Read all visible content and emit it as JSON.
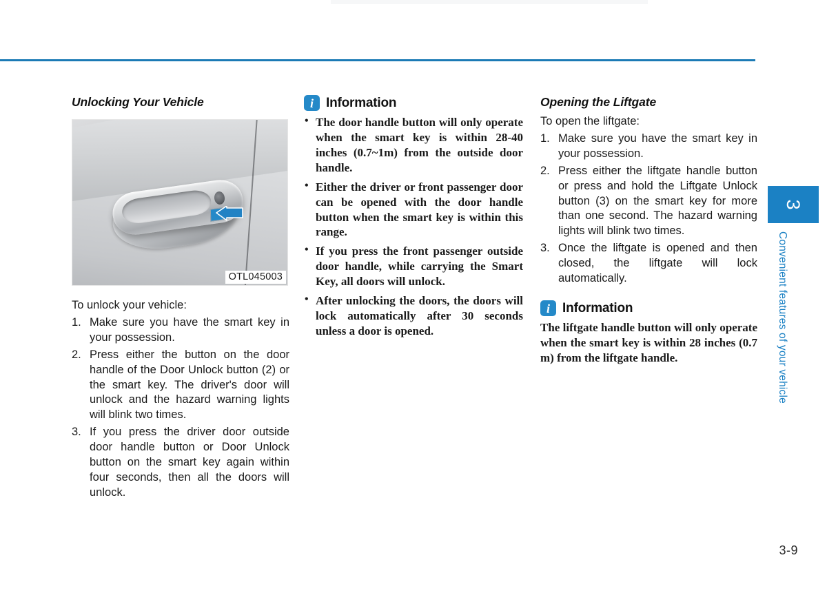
{
  "page": {
    "number": "3-9",
    "accent_color": "#1b81c4",
    "rule_color": "#1b7ab5"
  },
  "chapter_tab": {
    "number": "3",
    "label": "Convenient features of your vehicle"
  },
  "left_column": {
    "title": "Unlocking Your Vehicle",
    "figure": {
      "caption": "OTL045003",
      "icon": "car-door-handle-illustration",
      "arrow": "blue-arrow-pointing-to-door-handle-button"
    },
    "lead": "To unlock your vehicle:",
    "steps": [
      {
        "marker": "1.",
        "text": "Make sure you have the smart key in your possession."
      },
      {
        "marker": "2.",
        "text": "Press either the button on the door handle of the Door Unlock button (2) or the smart key. The driver's door will unlock and the hazard warning lights will blink two times."
      },
      {
        "marker": "3.",
        "text": "If you press the driver door outside door handle button or Door Unlock button on the smart key again within four seconds, then all the doors will unlock."
      }
    ]
  },
  "middle_column": {
    "information": {
      "icon": "information-icon",
      "title": "Information",
      "bullets": [
        "The door handle button will only operate when the smart key is within 28-40 inches (0.7~1m) from the outside door handle.",
        "Either the driver or front passenger door can be opened with the door handle button when the smart key is within this range.",
        "If you press the front passenger outside door handle, while carrying the Smart Key, all doors will unlock.",
        "After unlocking the doors, the doors will lock automatically after 30 seconds unless a door is opened."
      ]
    }
  },
  "right_column": {
    "title": "Opening the Liftgate",
    "lead": "To open the liftgate:",
    "steps": [
      {
        "marker": "1.",
        "text": "Make sure you have the smart key in your possession."
      },
      {
        "marker": "2.",
        "text": "Press either the liftgate handle button or press and hold the Liftgate Unlock button (3) on the smart key for more than one second. The hazard warning lights will blink two times."
      },
      {
        "marker": "3.",
        "text": "Once the liftgate is opened and then closed, the liftgate will lock automatically."
      }
    ],
    "information": {
      "icon": "information-icon",
      "title": "Information",
      "paragraph": "The liftgate handle button will only operate when the smart key is within 28 inches (0.7 m) from the liftgate handle."
    }
  }
}
